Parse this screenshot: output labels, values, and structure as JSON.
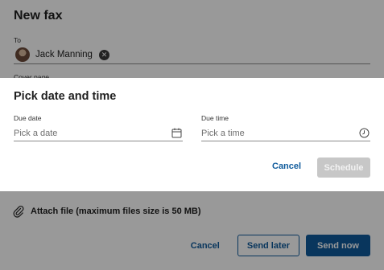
{
  "background": {
    "title": "New fax",
    "to_label": "To",
    "recipient": {
      "name": "Jack Manning"
    },
    "cover_label": "Cover page",
    "attach_label": "Attach file (maximum files size is 50 MB)",
    "actions": {
      "cancel": "Cancel",
      "send_later": "Send later",
      "send_now": "Send now"
    }
  },
  "dialog": {
    "title": "Pick date and time",
    "due_date": {
      "label": "Due date",
      "placeholder": "Pick a date",
      "value": ""
    },
    "due_time": {
      "label": "Due time",
      "placeholder": "Pick a time",
      "value": ""
    },
    "cancel": "Cancel",
    "schedule": "Schedule"
  },
  "colors": {
    "accent": "#0f5b9c",
    "disabled_button": "#c7c7c7",
    "overlay": "rgba(0,0,0,0.40)"
  },
  "icons": {
    "remove_recipient": "close-circle-icon",
    "attach": "paperclip-icon",
    "date": "calendar-icon",
    "time": "clock-icon"
  }
}
